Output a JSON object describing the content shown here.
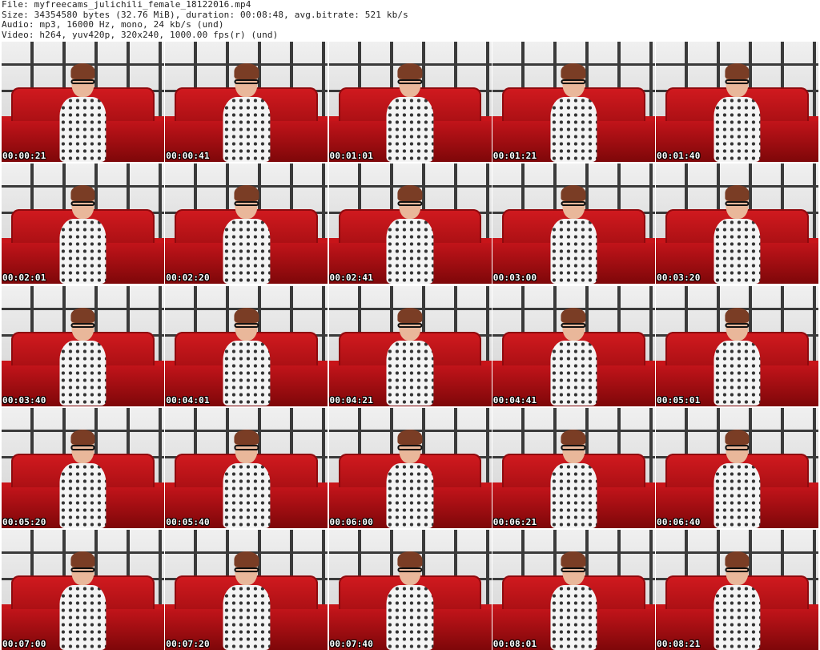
{
  "header": {
    "file_line": "File: myfreecams_julichili_female_18122016.mp4",
    "size_line": "Size: 34354580 bytes (32.76 MiB), duration: 00:08:48, avg.bitrate: 521 kb/s",
    "audio_line": "Audio: mp3, 16000 Hz, mono, 24 kb/s (und)",
    "video_line": "Video: h264, yuv420p, 320x240, 1000.00 fps(r) (und)"
  },
  "thumbnails": [
    {
      "timestamp": "00:00:21"
    },
    {
      "timestamp": "00:00:41"
    },
    {
      "timestamp": "00:01:01"
    },
    {
      "timestamp": "00:01:21"
    },
    {
      "timestamp": "00:01:40"
    },
    {
      "timestamp": "00:02:01"
    },
    {
      "timestamp": "00:02:20"
    },
    {
      "timestamp": "00:02:41"
    },
    {
      "timestamp": "00:03:00"
    },
    {
      "timestamp": "00:03:20"
    },
    {
      "timestamp": "00:03:40"
    },
    {
      "timestamp": "00:04:01"
    },
    {
      "timestamp": "00:04:21"
    },
    {
      "timestamp": "00:04:41"
    },
    {
      "timestamp": "00:05:01"
    },
    {
      "timestamp": "00:05:20"
    },
    {
      "timestamp": "00:05:40"
    },
    {
      "timestamp": "00:06:00"
    },
    {
      "timestamp": "00:06:21"
    },
    {
      "timestamp": "00:06:40"
    },
    {
      "timestamp": "00:07:00"
    },
    {
      "timestamp": "00:07:20"
    },
    {
      "timestamp": "00:07:40"
    },
    {
      "timestamp": "00:08:01"
    },
    {
      "timestamp": "00:08:21"
    }
  ],
  "colors": {
    "background": "#ffffff",
    "sofa_red": "#c81419",
    "timestamp_text": "#ffffff"
  }
}
